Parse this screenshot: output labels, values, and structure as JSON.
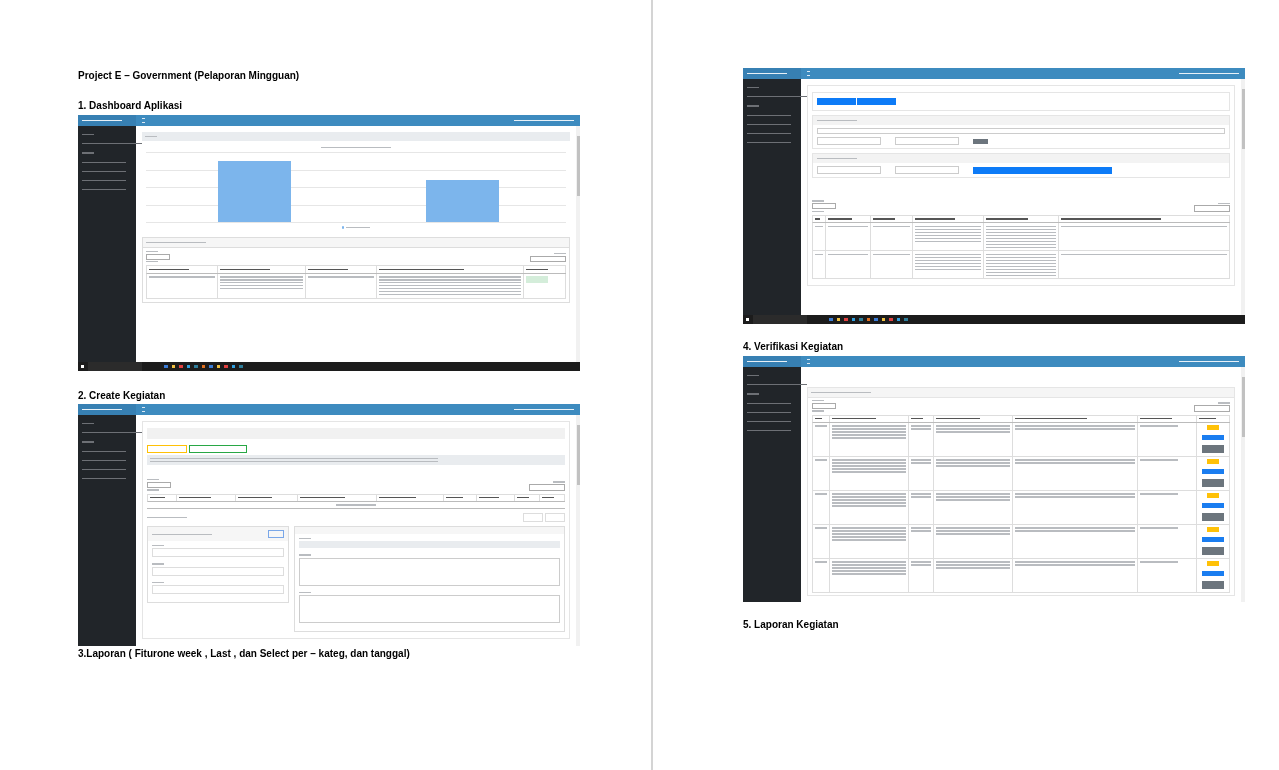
{
  "document": {
    "title": "Project E – Government  (Pelaporan Mingguan)"
  },
  "sections": [
    {
      "heading": "1. Dashboard Aplikasi",
      "screenshot": {
        "kind": "dashboard"
      }
    },
    {
      "heading": "2. Create Kegiatan",
      "screenshot": {
        "kind": "create"
      }
    },
    {
      "heading": "3.Laporan ( Fiturone week , Last , dan Select per – kateg, dan tanggal)",
      "screenshot": {
        "kind": "laporan"
      }
    },
    {
      "heading": "4. Verifikasi Kegiatan",
      "screenshot": {
        "kind": "verifikasi"
      }
    },
    {
      "heading": "5. Laporan Kegiatan"
    }
  ]
}
